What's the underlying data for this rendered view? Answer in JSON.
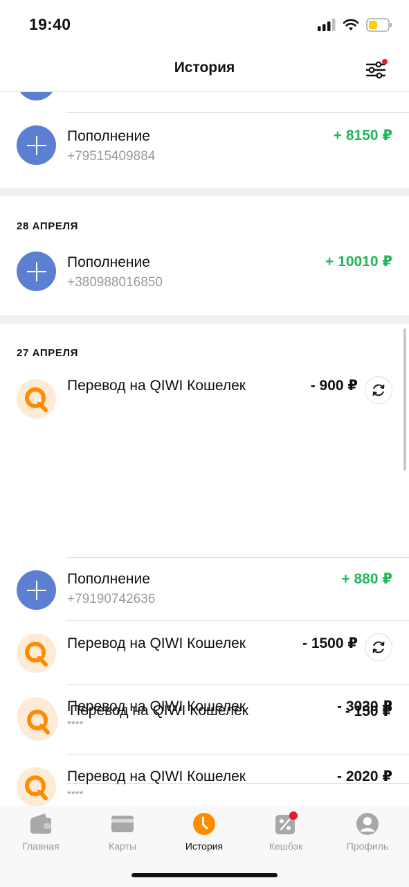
{
  "status_bar": {
    "time": "19:40"
  },
  "header": {
    "title": "История"
  },
  "sections": [
    {
      "date": "",
      "transactions": [
        {
          "title": "Пополнение",
          "subtitle": "+79515409884",
          "amount": "+ 8150 ₽",
          "direction": "in",
          "icon": "plus-icon"
        }
      ]
    },
    {
      "date": "28 АПРЕЛЯ",
      "transactions": [
        {
          "title": "Пополнение",
          "subtitle": "+380988016850",
          "amount": "+ 10010 ₽",
          "direction": "in",
          "icon": "plus-icon"
        }
      ]
    },
    {
      "date": "27 АПРЕЛЯ",
      "transactions": [
        {
          "title": "Перевод на QIWI Кошелек",
          "subtitle": "",
          "amount": "- 900 ₽",
          "direction": "out",
          "icon": "qiwi-icon",
          "repeat": true
        },
        {
          "title": "Пополнение",
          "subtitle": "+79190742636",
          "amount": "+ 880 ₽",
          "direction": "in",
          "icon": "plus-icon"
        },
        {
          "title": "Перевод на QIWI Кошелек",
          "subtitle": "",
          "amount": "- 1500 ₽",
          "direction": "out",
          "icon": "qiwi-icon",
          "repeat": true
        },
        {
          "title": "Перевод на QIWI Кошелек",
          "subtitle": "****",
          "amount": "- 3030 ₽",
          "direction": "out",
          "icon": "qiwi-icon"
        },
        {
          "title": "Перевод на QIWI Кошелек",
          "subtitle": "",
          "amount": "- 150 ₽",
          "direction": "out",
          "icon": "qiwi-icon"
        },
        {
          "title": "Перевод на QIWI Кошелек",
          "subtitle": "****",
          "amount": "- 2020 ₽",
          "direction": "out",
          "icon": "qiwi-icon"
        }
      ]
    }
  ],
  "tabbar": {
    "items": [
      {
        "label": "Главная",
        "icon": "wallet-icon",
        "active": false
      },
      {
        "label": "Карты",
        "icon": "card-icon",
        "active": false
      },
      {
        "label": "История",
        "icon": "clock-icon",
        "active": true
      },
      {
        "label": "Кешбэк",
        "icon": "percent-icon",
        "active": false,
        "badge": true
      },
      {
        "label": "Профиль",
        "icon": "profile-icon",
        "active": false
      }
    ]
  },
  "colors": {
    "accent": "#ff8c00",
    "income": "#21b85a",
    "expense": "#111111",
    "plus_icon_bg": "#5c7fd1",
    "qiwi_icon_bg": "#fdebd6",
    "badge": "#e8192c"
  }
}
